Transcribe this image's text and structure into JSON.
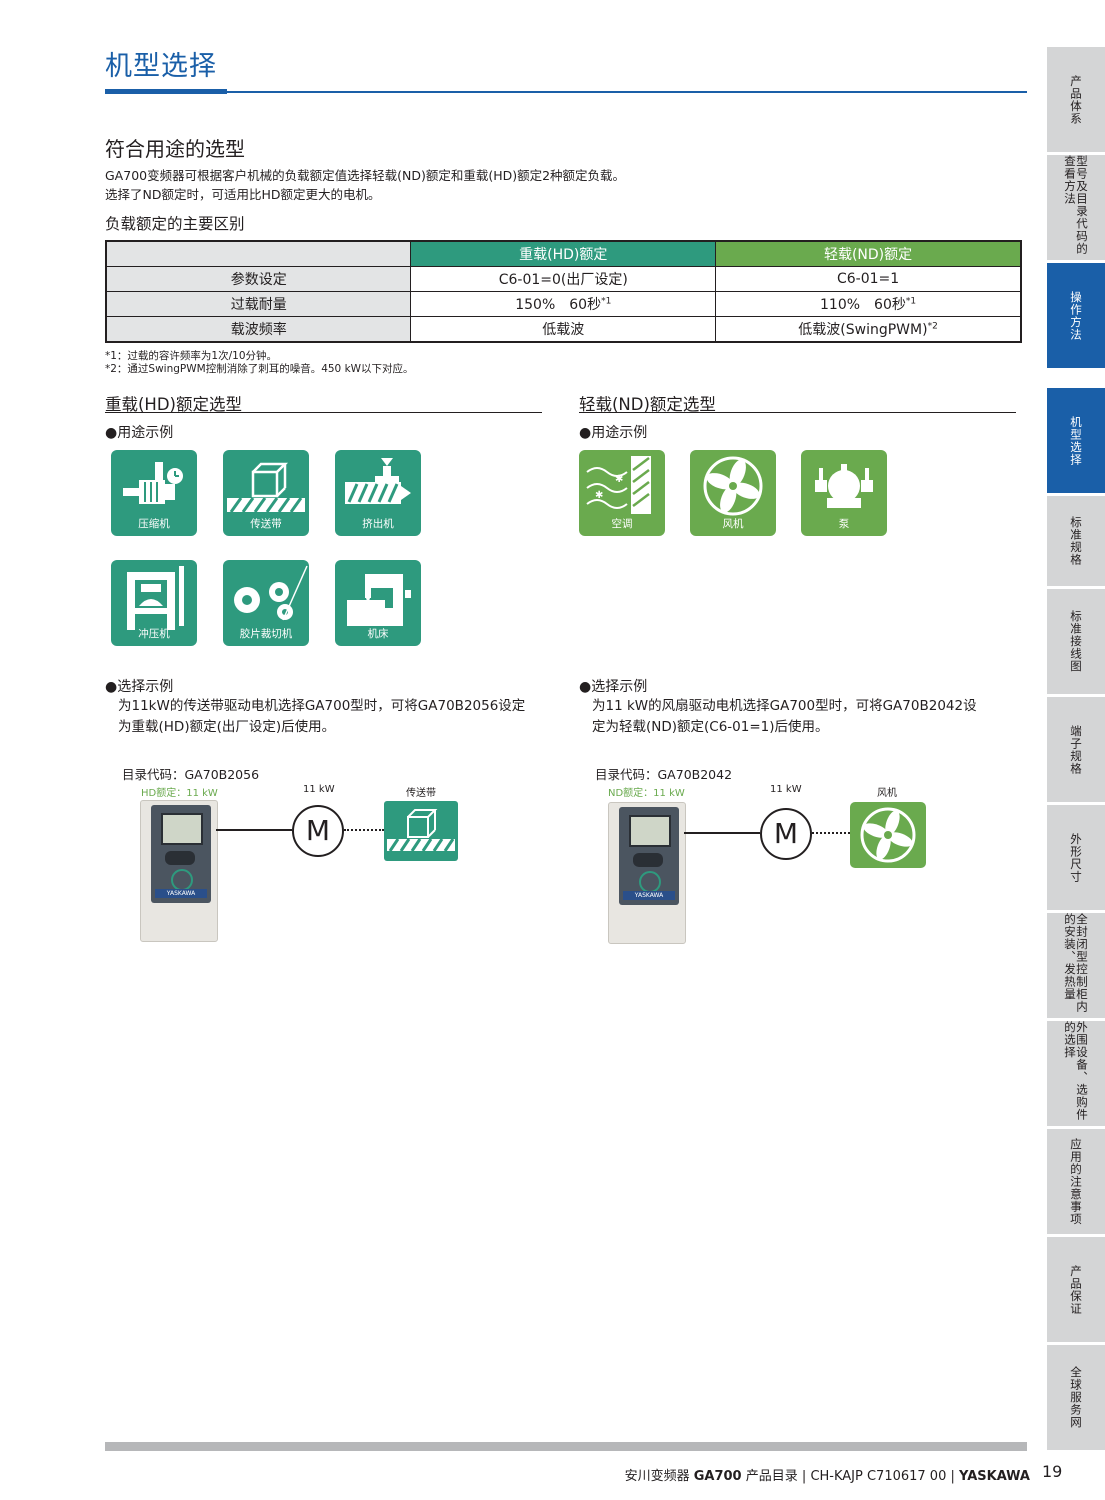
{
  "page": {
    "title": "机型选择",
    "section_title": "符合用途的选型",
    "intro_line1": "GA700变频器可根据客户机械的负载额定值选择轻载(ND)额定和重载(HD)额定2种额定负载。",
    "intro_line2": "选择了ND额定时，可适用比HD额定更大的电机。",
    "table_title": "负载额定的主要区别"
  },
  "table": {
    "headers": [
      "重载(HD)额定",
      "轻载(ND)额定"
    ],
    "rows": [
      {
        "label": "参数设定",
        "hd": "C6-01=0(出厂设定)",
        "nd": "C6-01=1",
        "hd_sup": "",
        "nd_sup": ""
      },
      {
        "label": "过载耐量",
        "hd": "150%　60秒",
        "nd": "110%　60秒",
        "hd_sup": "*1",
        "nd_sup": "*1"
      },
      {
        "label": "载波频率",
        "hd": "低载波",
        "nd": "低载波(SwingPWM)",
        "hd_sup": "",
        "nd_sup": "*2"
      }
    ]
  },
  "notes": [
    "*1：过载的容许频率为1次/10分钟。",
    "*2：通过SwingPWM控制消除了刺耳的噪音。450 kW以下对应。"
  ],
  "hd": {
    "title": "重载(HD)额定选型",
    "usage_label": "●用途示例",
    "icons": [
      "压缩机",
      "传送带",
      "挤出机",
      "冲压机",
      "胶片裁切机",
      "机床"
    ],
    "example_label": "●选择示例",
    "example_line1": "为11kW的传送带驱动电机选择GA700型时，可将GA70B2056设定",
    "example_line2": "为重载(HD)额定(出厂设定)后使用。",
    "code": "目录代码：GA70B2056",
    "rating": "HD额定：11 kW",
    "motor_power": "11 kW",
    "motor_symbol": "M",
    "load_label": "传送带"
  },
  "nd": {
    "title": "轻载(ND)额定选型",
    "usage_label": "●用途示例",
    "icons": [
      "空调",
      "风机",
      "泵"
    ],
    "example_label": "●选择示例",
    "example_line1": "为11 kW的风扇驱动电机选择GA700型时，可将GA70B2042设",
    "example_line2": "定为轻载(ND)额定(C6-01=1)后使用。",
    "code": "目录代码：GA70B2042",
    "rating": "ND额定：11 kW",
    "motor_power": "11 kW",
    "motor_symbol": "M",
    "load_label": "风机"
  },
  "drive_brand": "YASKAWA",
  "sidebar": [
    {
      "label": "产品体系",
      "active": false
    },
    {
      "label": "型号及目录代码的查看方法",
      "active": false
    },
    {
      "label": "操作方法",
      "active": true
    },
    {
      "label": "机型选择",
      "active": true
    },
    {
      "label": "标准规格",
      "active": false
    },
    {
      "label": "标准接线图",
      "active": false
    },
    {
      "label": "端子规格",
      "active": false
    },
    {
      "label": "外形尺寸",
      "active": false
    },
    {
      "label": "全封闭型控制柜内的安装、发热量",
      "active": false
    },
    {
      "label": "外围设备、选购件的选择",
      "active": false
    },
    {
      "label": "应用的注意事项",
      "active": false
    },
    {
      "label": "产品保证",
      "active": false
    },
    {
      "label": "全球服务网",
      "active": false
    }
  ],
  "footer": {
    "prefix": "安川变频器",
    "model": "GA700",
    "catalog": "产品目录",
    "sep": "|",
    "doc_code": "CH-KAJP C710617 00",
    "brand": "YASKAWA",
    "page_number": "19"
  },
  "colors": {
    "accent_blue": "#1a5fa8",
    "hd_teal": "#2e9a7e",
    "nd_green": "#6aaa4e",
    "tab_gray": "#d4d5d6"
  }
}
